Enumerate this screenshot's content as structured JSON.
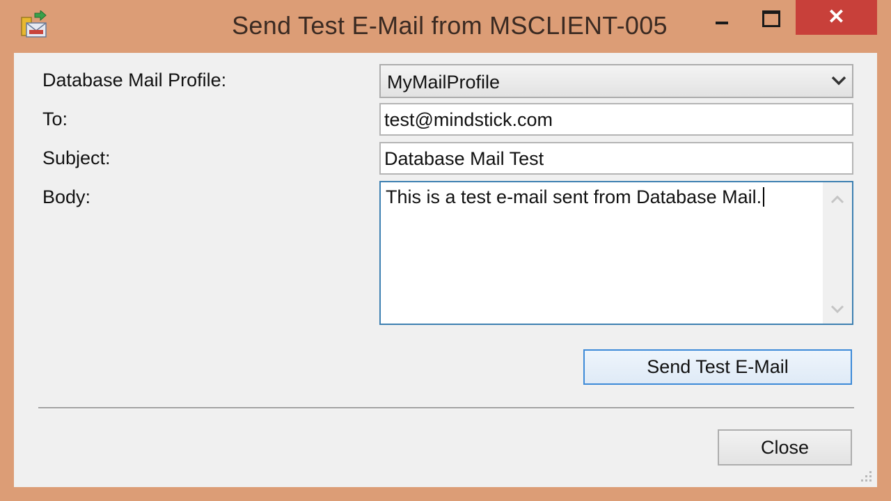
{
  "window": {
    "title": "Send Test E-Mail from MSCLIENT-005",
    "close_glyph": "✕"
  },
  "icons": {
    "app": "mail-envelope-icon",
    "minimize": "minimize-icon",
    "maximize": "maximize-icon",
    "close": "close-icon",
    "dropdown": "chevron-down-icon",
    "scroll_up": "chevron-up-icon",
    "scroll_down": "chevron-down-icon",
    "grip": "resize-grip-icon"
  },
  "colors": {
    "frame": "#dc9d76",
    "client": "#f0f0f0",
    "close_button": "#c8403a",
    "focus_border": "#3c7fb1",
    "default_button_border": "#3c8ad8"
  },
  "form": {
    "profile_label": "Database Mail Profile:",
    "profile_value": "MyMailProfile",
    "to_label": "To:",
    "to_value": "test@mindstick.com",
    "subject_label": "Subject:",
    "subject_value": "Database Mail Test",
    "body_label": "Body:",
    "body_value": "This is a test e-mail sent from Database Mail."
  },
  "buttons": {
    "send": "Send Test E-Mail",
    "close": "Close"
  }
}
